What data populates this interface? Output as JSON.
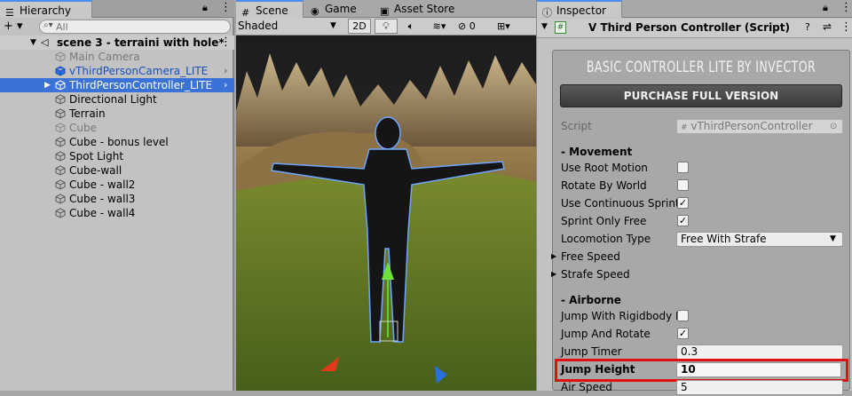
{
  "hierarchy": {
    "tab_label": "Hierarchy",
    "add_label": "+ ▾",
    "search_placeholder": "All",
    "scene_name": "scene 3 - terraini with hole*",
    "items": [
      {
        "label": "Main Camera",
        "state": "disabled"
      },
      {
        "label": "vThirdPersonCamera_LITE",
        "state": "prefab"
      },
      {
        "label": "ThirdPersonController_LITE",
        "state": "selected"
      },
      {
        "label": "Directional Light",
        "state": "normal"
      },
      {
        "label": "Terrain",
        "state": "normal"
      },
      {
        "label": "Cube",
        "state": "disabled"
      },
      {
        "label": "Cube - bonus level",
        "state": "normal"
      },
      {
        "label": "Spot Light",
        "state": "normal"
      },
      {
        "label": "Cube-wall",
        "state": "normal"
      },
      {
        "label": "Cube - wall2",
        "state": "normal"
      },
      {
        "label": "Cube - wall3",
        "state": "normal"
      },
      {
        "label": "Cube - wall4",
        "state": "normal"
      }
    ]
  },
  "scene": {
    "tabs": [
      "Scene",
      "Game",
      "Asset Store"
    ],
    "active_tab": "Scene",
    "shading_mode": "Shaded",
    "toggle_2d": "2D",
    "hidden_count": "0"
  },
  "inspector": {
    "tab_label": "Inspector",
    "component_title": "V Third Person Controller (Script)",
    "banner_title": "BASIC CONTROLLER LITE BY INVECTOR",
    "purchase_label": "PURCHASE FULL VERSION",
    "script_label": "Script",
    "script_value": "vThirdPersonController",
    "movement_header": "- Movement",
    "use_root_motion": {
      "label": "Use Root Motion",
      "checked": false
    },
    "rotate_by_world": {
      "label": "Rotate By World",
      "checked": false
    },
    "use_continuous_sprint": {
      "label": "Use Continuous Sprint",
      "checked": true
    },
    "sprint_only_free": {
      "label": "Sprint Only Free",
      "checked": true
    },
    "locomotion_type": {
      "label": "Locomotion Type",
      "value": "Free With Strafe"
    },
    "free_speed_label": "Free Speed",
    "strafe_speed_label": "Strafe Speed",
    "airborne_header": "- Airborne",
    "jump_with_rigidbody": {
      "label": "Jump With Rigidbody F",
      "checked": false
    },
    "jump_and_rotate": {
      "label": "Jump And Rotate",
      "checked": true
    },
    "jump_timer": {
      "label": "Jump Timer",
      "value": "0.3"
    },
    "jump_height": {
      "label": "Jump Height",
      "value": "10"
    },
    "air_speed": {
      "label": "Air Speed",
      "value": "5"
    }
  },
  "colors": {
    "selection": "#3a72d8",
    "highlight_border": "#e01010",
    "banner": "#4a4a4a"
  }
}
